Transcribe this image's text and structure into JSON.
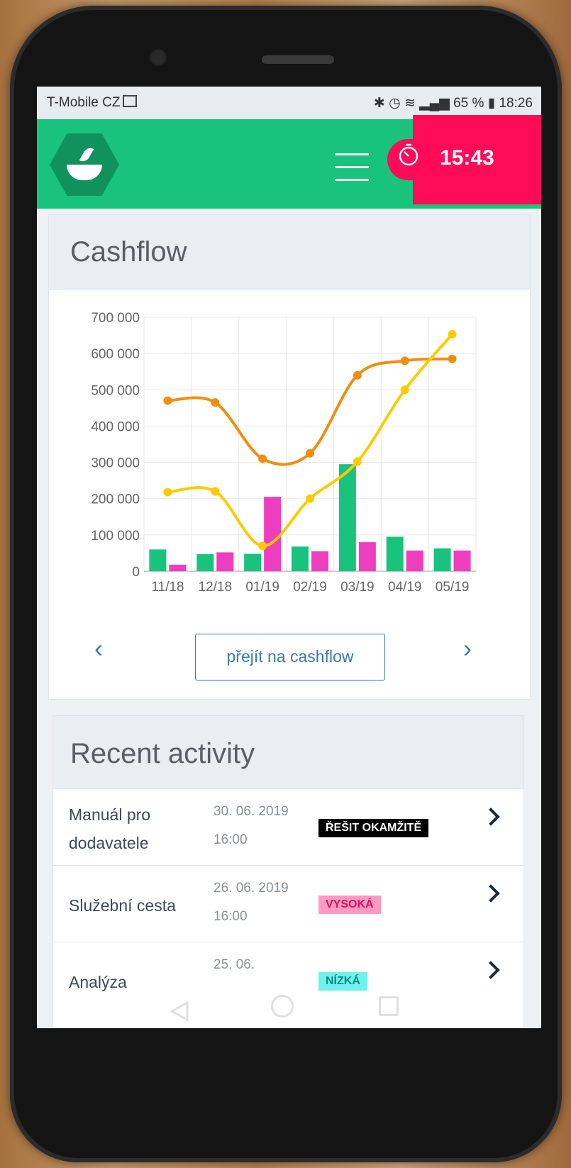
{
  "status_bar": {
    "carrier": "T-Mobile CZ",
    "battery": "65 %",
    "time": "18:26"
  },
  "app_bar": {
    "timer": "15:43",
    "colors": {
      "primary": "#19c37d",
      "timer_bg": "#ff0b57"
    }
  },
  "cashflow": {
    "title": "Cashflow",
    "button_label": "přejít na cashflow",
    "prev_label": "‹",
    "next_label": "›"
  },
  "chart_data": {
    "type": "bar",
    "categories": [
      "11/18",
      "12/18",
      "01/19",
      "02/19",
      "03/19",
      "04/19",
      "05/19"
    ],
    "yticks": [
      "0",
      "100 000",
      "200 000",
      "300 000",
      "400 000",
      "500 000",
      "600 000",
      "700 000"
    ],
    "ylim": [
      0,
      700000
    ],
    "grid": true,
    "series": [
      {
        "kind": "bar",
        "color": "#19c37d",
        "values": [
          60000,
          47000,
          48000,
          68000,
          295000,
          95000,
          63000
        ]
      },
      {
        "kind": "bar",
        "color": "#ee3dbf",
        "values": [
          18000,
          52000,
          205000,
          55000,
          80000,
          57000,
          57000
        ]
      },
      {
        "kind": "line",
        "color": "#f08e10",
        "values": [
          470000,
          465000,
          310000,
          325000,
          540000,
          580000,
          585000
        ]
      },
      {
        "kind": "line",
        "color": "#ffcb00",
        "values": [
          218000,
          220000,
          70000,
          200000,
          302000,
          500000,
          653000
        ]
      }
    ]
  },
  "recent": {
    "title": "Recent activity",
    "rows": [
      {
        "title": "Manuál pro dodavatele",
        "date": "30. 06. 2019 16:00",
        "badge": "ŘEŠIT OKAMŽITĚ",
        "badge_bg": "#000000",
        "badge_fg": "#ffffff"
      },
      {
        "title": "Služební cesta",
        "date": "26. 06. 2019 16:00",
        "badge": "VYSOKÁ",
        "badge_bg": "#ff9ac2",
        "badge_fg": "#d0155e"
      },
      {
        "title": "Analýza",
        "date": "25. 06.",
        "badge": "NÍZKÁ",
        "badge_bg": "#6ff1ee",
        "badge_fg": "#0a8a8a"
      }
    ]
  }
}
